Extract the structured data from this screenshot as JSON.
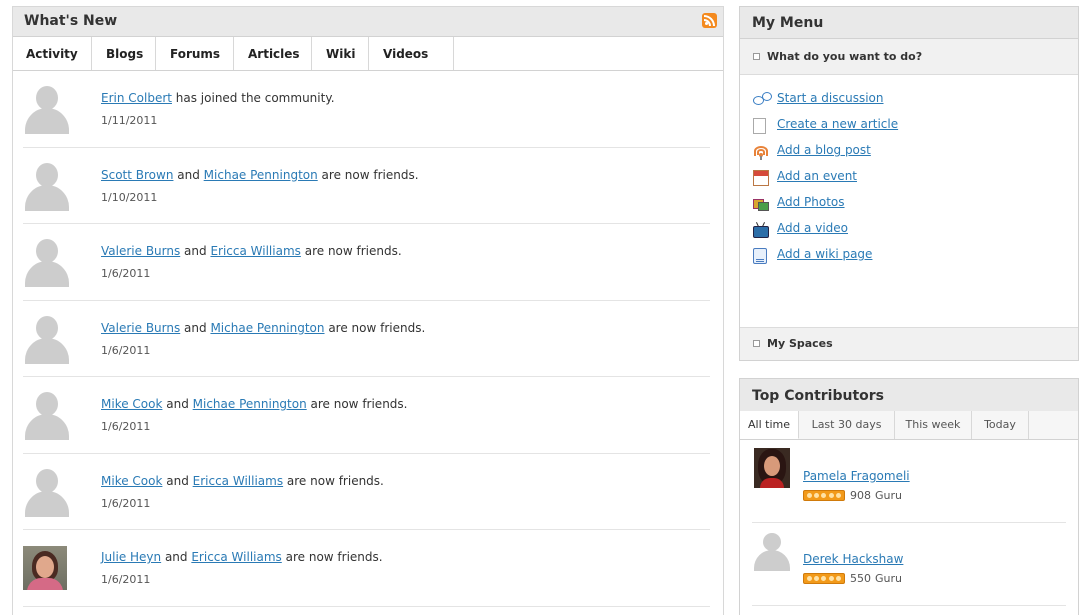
{
  "whats_new": {
    "title": "What's New",
    "tabs": [
      "Activity",
      "Blogs",
      "Forums",
      "Articles",
      "Wiki",
      "Videos"
    ],
    "active_tab": "Activity",
    "items": [
      {
        "user1": "Erin Colbert",
        "conj": "",
        "user2": "",
        "suffix": " has joined the community.",
        "date": "1/11/2011",
        "avatar": "generic"
      },
      {
        "user1": "Scott Brown",
        "conj": " and ",
        "user2": "Michae Pennington",
        "suffix": " are now friends.",
        "date": "1/10/2011",
        "avatar": "generic"
      },
      {
        "user1": "Valerie Burns",
        "conj": " and ",
        "user2": "Ericca Williams",
        "suffix": " are now friends.",
        "date": "1/6/2011",
        "avatar": "generic"
      },
      {
        "user1": "Valerie Burns",
        "conj": " and ",
        "user2": "Michae Pennington",
        "suffix": " are now friends.",
        "date": "1/6/2011",
        "avatar": "generic"
      },
      {
        "user1": "Mike Cook",
        "conj": " and ",
        "user2": "Michae Pennington",
        "suffix": " are now friends.",
        "date": "1/6/2011",
        "avatar": "generic"
      },
      {
        "user1": "Mike Cook",
        "conj": " and ",
        "user2": "Ericca Williams",
        "suffix": " are now friends.",
        "date": "1/6/2011",
        "avatar": "generic"
      },
      {
        "user1": "Julie Heyn",
        "conj": " and ",
        "user2": "Ericca Williams",
        "suffix": " are now friends.",
        "date": "1/6/2011",
        "avatar": "photo"
      }
    ]
  },
  "my_menu": {
    "title": "My Menu",
    "section1": "What do you want to do?",
    "actions": [
      {
        "label": "Start a discussion",
        "icon": "discussion-icon"
      },
      {
        "label": "Create a new article",
        "icon": "article-icon"
      },
      {
        "label": "Add a blog post",
        "icon": "blog-icon"
      },
      {
        "label": "Add an event",
        "icon": "calendar-icon"
      },
      {
        "label": "Add Photos",
        "icon": "photos-icon"
      },
      {
        "label": "Add a video",
        "icon": "tv-icon"
      },
      {
        "label": "Add a wiki page",
        "icon": "wiki-icon"
      }
    ],
    "section2": "My Spaces"
  },
  "top_contributors": {
    "title": "Top Contributors",
    "tabs": [
      "All time",
      "Last 30 days",
      "This week",
      "Today"
    ],
    "active_tab": "All time",
    "items": [
      {
        "name": "Pamela Fragomeli",
        "points": "908",
        "rank": "Guru",
        "avatar": "photo"
      },
      {
        "name": "Derek Hackshaw",
        "points": "550",
        "rank": "Guru",
        "avatar": "generic"
      }
    ]
  },
  "colors": {
    "link": "#2a7ab5",
    "header_bg": "#e9e9e9",
    "rss": "#f48a1f",
    "badge": "#f29a1a"
  }
}
